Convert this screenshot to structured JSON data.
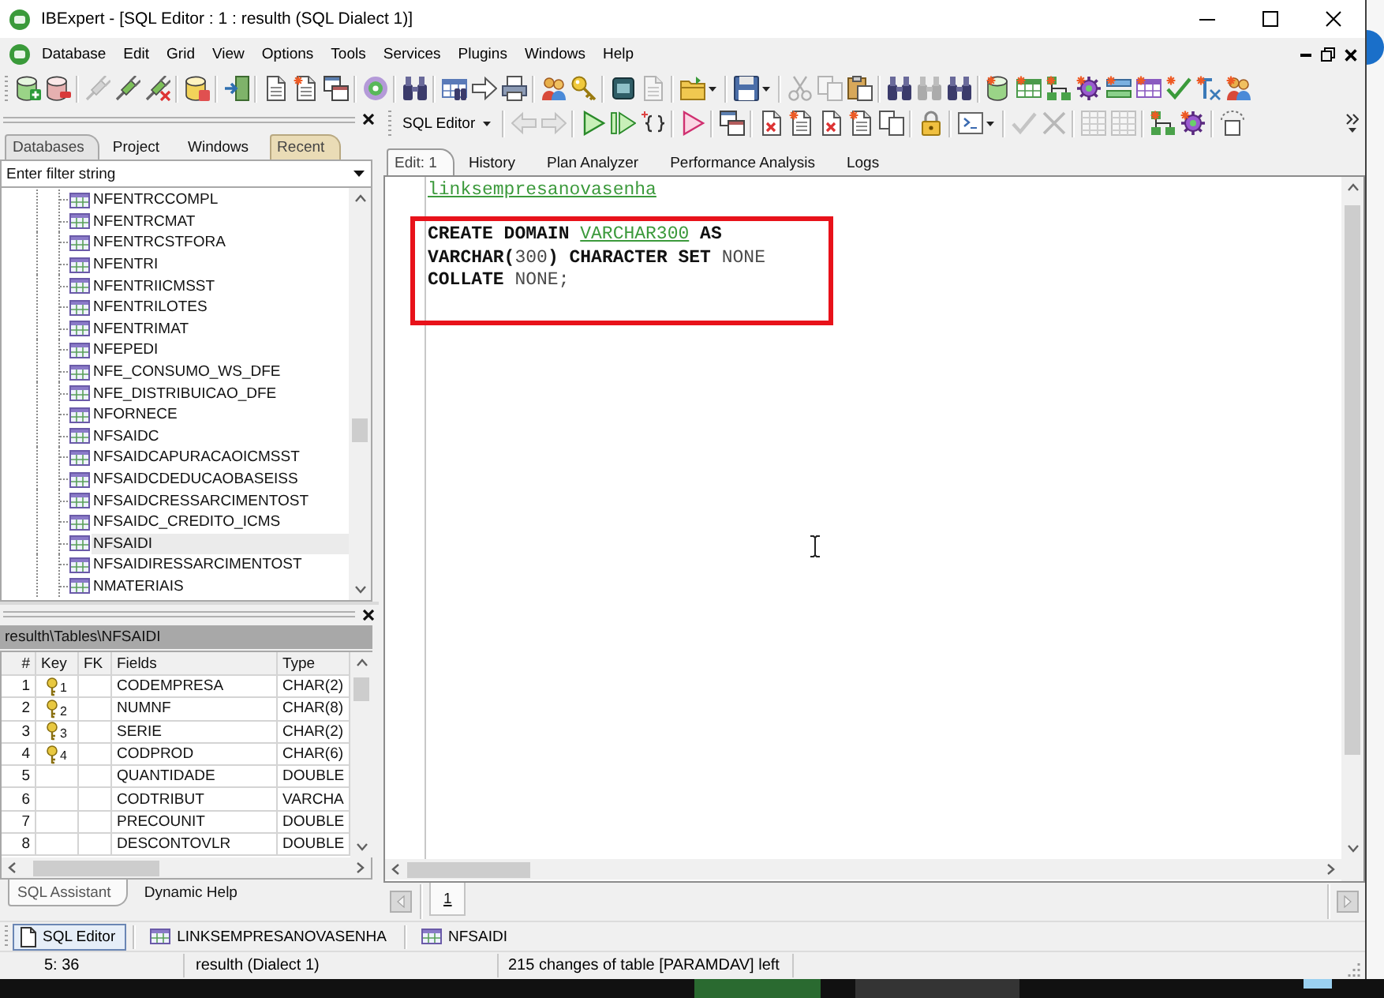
{
  "window": {
    "title": "IBExpert - [SQL Editor : 1 : resulth (SQL Dialect 1)]"
  },
  "menu": [
    "Database",
    "Edit",
    "Grid",
    "View",
    "Options",
    "Tools",
    "Services",
    "Plugins",
    "Windows",
    "Help"
  ],
  "main_toolbar": [
    {
      "kind": "button",
      "disabled": false
    },
    {
      "kind": "button",
      "disabled": false
    },
    {
      "kind": "separator"
    },
    {
      "kind": "button",
      "disabled": true
    },
    {
      "kind": "button",
      "disabled": false
    },
    {
      "kind": "button",
      "disabled": false
    },
    {
      "kind": "separator"
    },
    {
      "kind": "button",
      "disabled": false
    },
    {
      "kind": "separator"
    },
    {
      "kind": "button",
      "disabled": false
    },
    {
      "kind": "separator"
    },
    {
      "kind": "button",
      "disabled": false
    },
    {
      "kind": "button",
      "disabled": false
    },
    {
      "kind": "button",
      "disabled": false
    },
    {
      "kind": "separator"
    },
    {
      "kind": "button",
      "disabled": false
    },
    {
      "kind": "separator"
    },
    {
      "kind": "button",
      "disabled": false
    },
    {
      "kind": "separator"
    },
    {
      "kind": "button",
      "disabled": false
    },
    {
      "kind": "button",
      "disabled": false
    },
    {
      "kind": "button",
      "disabled": false
    },
    {
      "kind": "separator"
    },
    {
      "kind": "button",
      "disabled": false
    },
    {
      "kind": "button",
      "disabled": false
    },
    {
      "kind": "separator"
    },
    {
      "kind": "button",
      "disabled": false
    },
    {
      "kind": "button",
      "disabled": true
    },
    {
      "kind": "separator"
    },
    {
      "kind": "split",
      "disabled": false
    },
    {
      "kind": "separator"
    },
    {
      "kind": "split",
      "disabled": false
    },
    {
      "kind": "separator"
    },
    {
      "kind": "button",
      "disabled": true
    },
    {
      "kind": "button",
      "disabled": true
    },
    {
      "kind": "button",
      "disabled": false
    },
    {
      "kind": "separator"
    },
    {
      "kind": "button",
      "disabled": false
    },
    {
      "kind": "button",
      "disabled": true
    },
    {
      "kind": "button",
      "disabled": false
    },
    {
      "kind": "separator"
    },
    {
      "kind": "button",
      "disabled": false
    },
    {
      "kind": "button",
      "disabled": false
    },
    {
      "kind": "button",
      "disabled": false
    },
    {
      "kind": "button",
      "disabled": false
    },
    {
      "kind": "button",
      "disabled": false
    },
    {
      "kind": "button",
      "disabled": false
    },
    {
      "kind": "button",
      "disabled": false
    },
    {
      "kind": "button",
      "disabled": false
    },
    {
      "kind": "button",
      "disabled": false
    }
  ],
  "editor_toolbar": [
    {
      "kind": "mode",
      "label": "SQL Editor"
    },
    {
      "kind": "separator"
    },
    {
      "kind": "button",
      "disabled": true
    },
    {
      "kind": "button",
      "disabled": true
    },
    {
      "kind": "separator"
    },
    {
      "kind": "button",
      "disabled": false
    },
    {
      "kind": "button",
      "disabled": false
    },
    {
      "kind": "button",
      "disabled": false
    },
    {
      "kind": "separator"
    },
    {
      "kind": "button",
      "disabled": false
    },
    {
      "kind": "separator"
    },
    {
      "kind": "button",
      "disabled": false
    },
    {
      "kind": "separator"
    },
    {
      "kind": "button",
      "disabled": false
    },
    {
      "kind": "button",
      "disabled": false
    },
    {
      "kind": "button",
      "disabled": false
    },
    {
      "kind": "button",
      "disabled": false
    },
    {
      "kind": "button",
      "disabled": false
    },
    {
      "kind": "separator"
    },
    {
      "kind": "button",
      "disabled": false
    },
    {
      "kind": "separator"
    },
    {
      "kind": "split",
      "disabled": false
    },
    {
      "kind": "separator"
    },
    {
      "kind": "button",
      "disabled": true
    },
    {
      "kind": "button",
      "disabled": true
    },
    {
      "kind": "separator"
    },
    {
      "kind": "button",
      "disabled": true
    },
    {
      "kind": "button",
      "disabled": true
    },
    {
      "kind": "separator"
    },
    {
      "kind": "button",
      "disabled": false
    },
    {
      "kind": "button",
      "disabled": false
    },
    {
      "kind": "separator"
    },
    {
      "kind": "button",
      "disabled": false
    }
  ],
  "database_explorer": {
    "tabs": [
      {
        "label": "Databases",
        "selected": true
      },
      {
        "label": "Project",
        "selected": false
      },
      {
        "label": "Windows",
        "selected": false
      },
      {
        "label": "Recent",
        "selected": false,
        "color": "#eadcb6"
      }
    ],
    "filter": {
      "placeholder": "Enter filter string"
    },
    "tree": [
      {
        "label": "NFENTRCCOMPL",
        "selected": false
      },
      {
        "label": "NFENTRCMAT",
        "selected": false
      },
      {
        "label": "NFENTRCSTFORA",
        "selected": false
      },
      {
        "label": "NFENTRI",
        "selected": false
      },
      {
        "label": "NFENTRIICMSST",
        "selected": false
      },
      {
        "label": "NFENTRILOTES",
        "selected": false
      },
      {
        "label": "NFENTRIMAT",
        "selected": false
      },
      {
        "label": "NFEPEDI",
        "selected": false
      },
      {
        "label": "NFE_CONSUMO_WS_DFE",
        "selected": false
      },
      {
        "label": "NFE_DISTRIBUICAO_DFE",
        "selected": false
      },
      {
        "label": "NFORNECE",
        "selected": false
      },
      {
        "label": "NFSAIDC",
        "selected": false
      },
      {
        "label": "NFSAIDCAPURACAOICMSST",
        "selected": false
      },
      {
        "label": "NFSAIDCDEDUCAOBASEISS",
        "selected": false
      },
      {
        "label": "NFSAIDCRESSARCIMENTOST",
        "selected": false
      },
      {
        "label": "NFSAIDC_CREDITO_ICMS",
        "selected": false
      },
      {
        "label": "NFSAIDI",
        "selected": true
      },
      {
        "label": "NFSAIDIRESSARCIMENTOST",
        "selected": false
      },
      {
        "label": "NMATERIAIS",
        "selected": false
      }
    ]
  },
  "field_list": {
    "path": "resulth\\Tables\\NFSAIDI",
    "columns": [
      "#",
      "Key",
      "FK",
      "Fields",
      "Type"
    ],
    "rows": [
      {
        "number": "1",
        "key": "1",
        "field": "CODEMPRESA",
        "type": "CHAR(2)"
      },
      {
        "number": "2",
        "key": "2",
        "field": "NUMNF",
        "type": "CHAR(8)"
      },
      {
        "number": "3",
        "key": "3",
        "field": "SERIE",
        "type": "CHAR(2)"
      },
      {
        "number": "4",
        "key": "4",
        "field": "CODPROD",
        "type": "CHAR(6)"
      },
      {
        "number": "5",
        "field": "QUANTIDADE",
        "type": "DOUBLE"
      },
      {
        "number": "6",
        "field": "CODTRIBUT",
        "type": "VARCHA"
      },
      {
        "number": "7",
        "field": "PRECOUNIT",
        "type": "DOUBLE"
      },
      {
        "number": "8",
        "field": "DESCONTOVLR",
        "type": "DOUBLE"
      }
    ]
  },
  "assistant_tabs": [
    {
      "label": "SQL Assistant",
      "selected": true
    },
    {
      "label": "Dynamic Help",
      "selected": false
    }
  ],
  "editor": {
    "tabs": [
      {
        "label": "Edit: 1",
        "selected": true
      },
      {
        "label": "History",
        "selected": false
      },
      {
        "label": "Plan Analyzer",
        "selected": false
      },
      {
        "label": "Performance Analysis",
        "selected": false
      },
      {
        "label": "Logs",
        "selected": false
      }
    ],
    "lines": [
      {
        "boxed": false,
        "tokens": [
          {
            "kind": "identifier",
            "text": "linksempresanovasenha"
          }
        ]
      },
      {
        "boxed": false
      },
      {
        "boxed": true,
        "tokens": [
          {
            "kind": "keyword",
            "text": "CREATE DOMAIN "
          },
          {
            "kind": "identifier",
            "text": "VARCHAR300"
          },
          {
            "kind": "keyword",
            "text": " AS"
          }
        ]
      },
      {
        "boxed": true,
        "tokens": [
          {
            "kind": "keyword",
            "text": "VARCHAR("
          },
          {
            "kind": "plain",
            "text": "300"
          },
          {
            "kind": "keyword",
            "text": ") CHARACTER SET "
          },
          {
            "kind": "plain",
            "text": "NONE"
          }
        ]
      },
      {
        "boxed": true,
        "tokens": [
          {
            "kind": "keyword",
            "text": "COLLATE "
          },
          {
            "kind": "plain",
            "text": "NONE;"
          }
        ]
      },
      {
        "boxed": true
      }
    ],
    "pages": [
      {
        "label": "1",
        "selected": true
      }
    ]
  },
  "window_bar": [
    {
      "kind": "editor",
      "label": "SQL Editor",
      "selected": true
    },
    {
      "kind": "table",
      "label": "LINKSEMPRESANOVASENHA",
      "selected": false
    },
    {
      "kind": "table",
      "label": "NFSAIDI",
      "selected": false
    }
  ],
  "status_bar": [
    "5: 36",
    "resulth (Dialect 1)",
    "215 changes of table [PARAMDAV] left"
  ]
}
